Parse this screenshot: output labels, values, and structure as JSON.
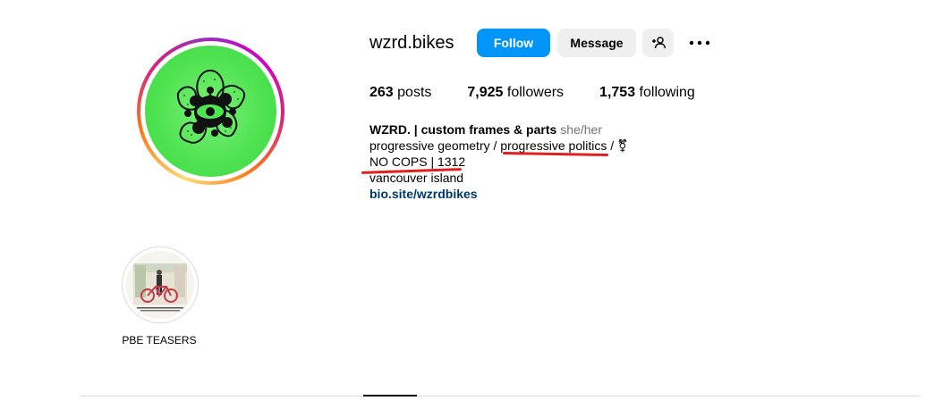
{
  "profile": {
    "username": "wzrd.bikes",
    "follow_label": "Follow",
    "message_label": "Message",
    "stats": {
      "posts_count": "263",
      "posts_label": "posts",
      "followers_count": "7,925",
      "followers_label": "followers",
      "following_count": "1,753",
      "following_label": "following"
    },
    "bio": {
      "name": "WZRD. | custom frames & parts",
      "pronouns": "she/her",
      "line1_a": "progressive geometry / ",
      "line1_b": "progressive politics",
      "line1_c": " / ⚧",
      "line2": "NO COPS | 1312",
      "line3": "vancouver island",
      "link": "bio.site/wzrdbikes"
    }
  },
  "highlights": [
    {
      "label": "PBE TEASERS"
    }
  ],
  "icons": [
    "add-user-icon",
    "more-options-icon",
    "profile-flower-logo"
  ],
  "colors": {
    "follow_button": "#0095f6",
    "secondary_button": "#efefef",
    "link": "#00376b",
    "annotation_underline": "#e02020",
    "avatar_bg": "#50e352"
  }
}
